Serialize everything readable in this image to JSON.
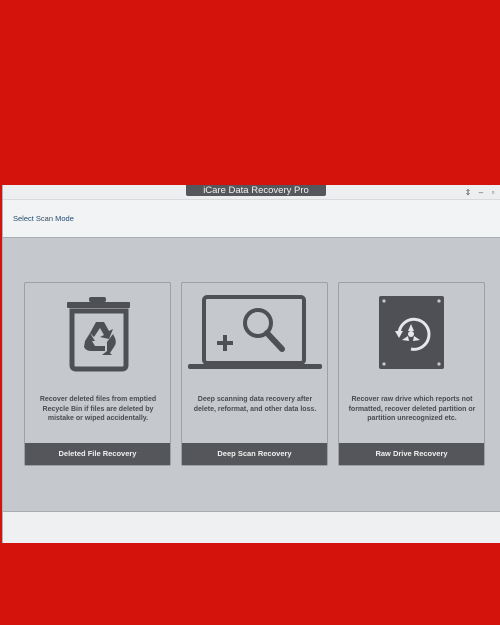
{
  "window": {
    "title": "iCare Data Recovery Pro",
    "controls": {
      "restore": "⇕",
      "minimize": "–",
      "close": "▫"
    }
  },
  "header": {
    "label": "Select Scan Mode"
  },
  "cards": [
    {
      "icon": "recycle-bin-icon",
      "description": "Recover deleted files from emptied Recycle Bin if files are deleted by mistake or wiped accidentally.",
      "button": "Deleted File Recovery"
    },
    {
      "icon": "laptop-search-icon",
      "description": "Deep scanning data recovery after delete, reformat, and other data loss.",
      "button": "Deep Scan Recovery"
    },
    {
      "icon": "hard-drive-icon",
      "description": "Recover raw drive which reports not formatted, recover deleted partition or partition unrecognized etc.",
      "button": "Raw Drive Recovery"
    }
  ],
  "colors": {
    "background": "#d4140c",
    "panel": "#c5c8cc",
    "button": "#55565c",
    "icon": "#4f5056"
  }
}
